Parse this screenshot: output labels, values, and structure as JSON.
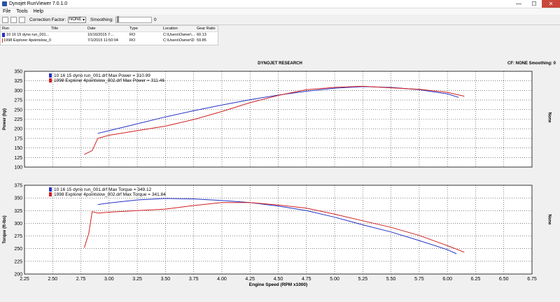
{
  "window": {
    "title": "Dynojet RunViewer 7.0.1.0",
    "minimize": "—",
    "maximize": "☐",
    "close": "✕"
  },
  "menu": {
    "items": [
      "File",
      "Tools",
      "Help"
    ]
  },
  "toolbar": {
    "correction_label": "Correction Factor:",
    "correction_value": "NONE",
    "smoothing_label": "Smoothing:",
    "smoothing_value": "0"
  },
  "runs_table": {
    "headers": [
      "Run",
      "Title",
      "Date",
      "Type",
      "Location",
      "Gear Ratio"
    ],
    "rows": [
      {
        "run": "10 16 15 dyno run_001...",
        "title": "",
        "date": "10/16/2015 7:...",
        "type": "RO",
        "location": "C:\\Users\\Owner\\...",
        "gear_ratio": "60.13",
        "color": "#2432c8"
      },
      {
        "run": "1998 Explorer 4pointslow_0",
        "title": "",
        "date": "7/1/2015 11:50:04",
        "type": "RO",
        "location": "C:\\Users\\Owner\\D",
        "gear_ratio": "59.85",
        "color": "#d11f1f"
      }
    ]
  },
  "chart_header": {
    "title": "DYNOJET RESEARCH",
    "right": "CF: NONE  Smoothing: 0",
    "right_unit_power": "None",
    "right_unit_torque": "None"
  },
  "colors": {
    "series1": "#2432c8",
    "series2": "#d11f1f"
  },
  "chart_data": [
    {
      "type": "line",
      "ylabel": "Power (hp)",
      "xlabel": "Engine Speed (RPM x1000)",
      "xlim": [
        2.25,
        6.75
      ],
      "ylim": [
        100,
        350
      ],
      "xticks": [
        "2.25",
        "2.50",
        "2.75",
        "3.00",
        "3.25",
        "3.50",
        "3.75",
        "4.00",
        "4.25",
        "4.50",
        "4.75",
        "5.00",
        "5.25",
        "5.50",
        "5.75",
        "6.00",
        "6.25",
        "6.50",
        "6.75"
      ],
      "yticks": [
        "100",
        "125",
        "150",
        "175",
        "200",
        "225",
        "250",
        "275",
        "300",
        "325",
        "350"
      ],
      "grid": true,
      "legend": [
        "10 16 15 dyno run_001.drf Max Power = 310.99",
        "1998 Explorer 4pointslow_002.drf Max Power = 311.46"
      ],
      "series": [
        {
          "name": "10 16 15 dyno run_001.drf",
          "x": [
            2.9,
            3.0,
            3.25,
            3.5,
            3.75,
            4.0,
            4.25,
            4.5,
            4.75,
            5.0,
            5.25,
            5.5,
            5.75,
            6.0,
            6.1
          ],
          "y": [
            188,
            195,
            213,
            231,
            247,
            262,
            276,
            288,
            298,
            306,
            310,
            308,
            302,
            291,
            282
          ]
        },
        {
          "name": "1998 Explorer 4pointslow_002.drf",
          "x": [
            2.78,
            2.85,
            2.9,
            3.0,
            3.25,
            3.5,
            3.75,
            4.0,
            4.25,
            4.5,
            4.75,
            5.0,
            5.25,
            5.5,
            5.75,
            6.0,
            6.15
          ],
          "y": [
            133,
            143,
            175,
            183,
            195,
            207,
            224,
            245,
            268,
            287,
            302,
            308,
            311,
            307,
            303,
            295,
            285
          ]
        }
      ]
    },
    {
      "type": "line",
      "ylabel": "Torque (ft-lbs)",
      "xlabel": "Engine Speed (RPM x1000)",
      "xlim": [
        2.25,
        6.75
      ],
      "ylim": [
        200,
        375
      ],
      "xticks": [
        "2.25",
        "2.50",
        "2.75",
        "3.00",
        "3.25",
        "3.50",
        "3.75",
        "4.00",
        "4.25",
        "4.50",
        "4.75",
        "5.00",
        "5.25",
        "5.50",
        "5.75",
        "6.00",
        "6.25",
        "6.50",
        "6.75"
      ],
      "yticks": [
        "200",
        "225",
        "250",
        "275",
        "300",
        "325",
        "350",
        "375"
      ],
      "grid": true,
      "legend": [
        "10 16 15 dyno run_001.drf Max Torque = 349.12",
        "1998 Explorer 4pointslow_002.drf Max Torque = 341.84"
      ],
      "series": [
        {
          "name": "10 16 15 dyno run_001.drf",
          "x": [
            2.9,
            3.0,
            3.25,
            3.5,
            3.75,
            4.0,
            4.25,
            4.5,
            4.75,
            5.0,
            5.25,
            5.5,
            5.75,
            6.0,
            6.08
          ],
          "y": [
            337,
            340,
            346,
            349,
            348,
            345,
            341,
            334,
            325,
            312,
            297,
            283,
            266,
            248,
            240
          ]
        },
        {
          "name": "1998 Explorer 4pointslow_002.drf",
          "x": [
            2.78,
            2.82,
            2.85,
            2.9,
            3.0,
            3.25,
            3.5,
            3.75,
            4.0,
            4.25,
            4.5,
            4.75,
            5.0,
            5.25,
            5.5,
            5.75,
            6.0,
            6.15
          ],
          "y": [
            252,
            280,
            323,
            320,
            322,
            325,
            328,
            335,
            341,
            341,
            336,
            330,
            318,
            305,
            292,
            276,
            256,
            243
          ]
        }
      ]
    }
  ]
}
